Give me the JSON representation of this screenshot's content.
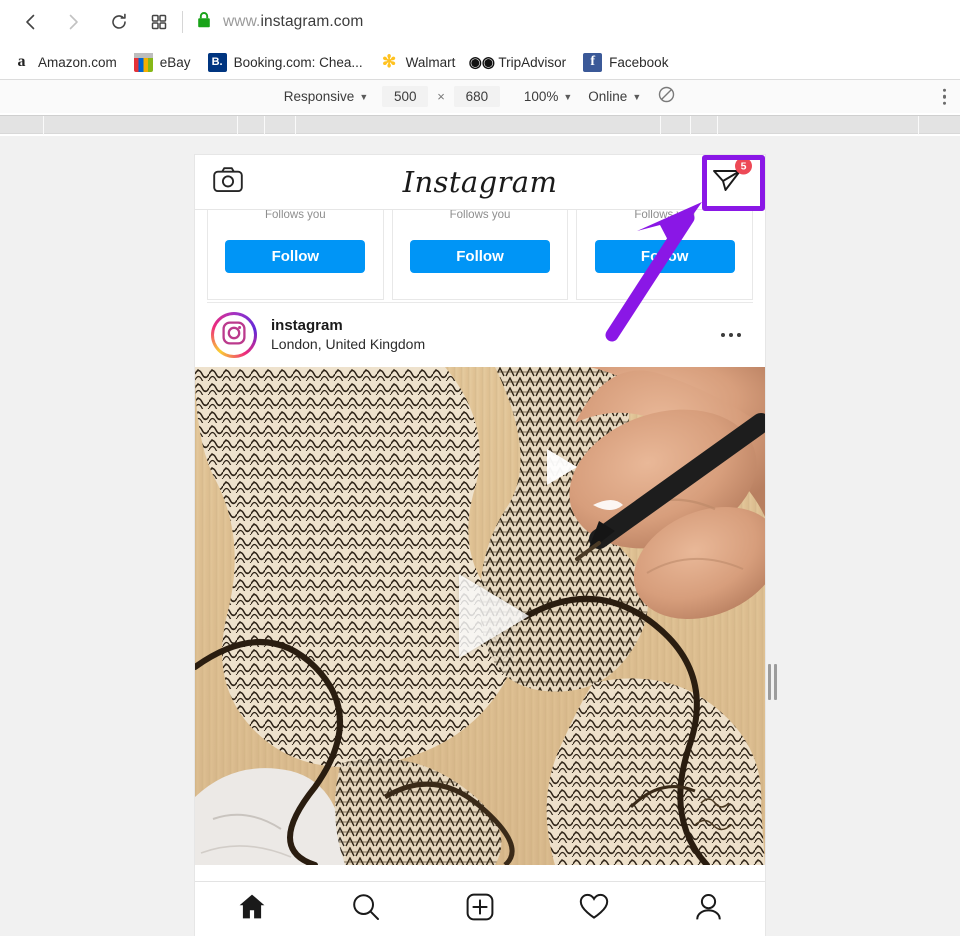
{
  "browser": {
    "url_protocol_prefix": "www.",
    "url": "instagram.com",
    "url_full": "www.instagram.com",
    "back_icon": "back-arrow-icon",
    "forward_icon": "forward-arrow-icon",
    "reload_icon": "reload-icon",
    "apps_icon": "grid-apps-icon",
    "lock_icon": "padlock-icon",
    "bookmarks": [
      {
        "label": "Amazon.com",
        "glyph": "a",
        "icon": "amazon-icon"
      },
      {
        "label": "eBay",
        "glyph": "",
        "icon": "ebay-icon"
      },
      {
        "label": "Booking.com: Chea...",
        "glyph": "B.",
        "icon": "booking-icon"
      },
      {
        "label": "Walmart",
        "glyph": "✻",
        "icon": "walmart-icon"
      },
      {
        "label": "TripAdvisor",
        "glyph": "◉◉",
        "icon": "tripadvisor-icon"
      },
      {
        "label": "Facebook",
        "glyph": "f",
        "icon": "facebook-icon"
      }
    ]
  },
  "device_toolbar": {
    "device_label": "Responsive",
    "width": "500",
    "separator": "×",
    "height": "680",
    "zoom": "100%",
    "network": "Online",
    "throttle_icon": "no-throttling-icon",
    "menu_icon": "kebab-menu-icon",
    "caret": "▼"
  },
  "ruler": {
    "ticks": [
      43,
      237,
      264,
      295,
      660,
      690,
      717,
      918
    ]
  },
  "instagram": {
    "header": {
      "camera_icon": "camera-icon",
      "logo": "Instagram",
      "dm_icon": "direct-message-icon",
      "dm_badge": "5"
    },
    "suggestions": [
      {
        "note": "Follows you",
        "follow_label": "Follow"
      },
      {
        "note": "Follows you",
        "follow_label": "Follow"
      },
      {
        "note": "Follows you",
        "follow_label": "Follow"
      }
    ],
    "post": {
      "avatar_icon": "instagram-avatar-icon",
      "username": "instagram",
      "location": "London, United Kingdom",
      "options_icon": "more-options-icon",
      "play_icon": "play-triangle-icon"
    },
    "bottom_nav": [
      {
        "icon": "home-icon",
        "name": "nav-home"
      },
      {
        "icon": "search-icon",
        "name": "nav-search"
      },
      {
        "icon": "add-post-icon",
        "name": "nav-add"
      },
      {
        "icon": "heart-icon",
        "name": "nav-activity"
      },
      {
        "icon": "profile-icon",
        "name": "nav-profile"
      }
    ]
  },
  "annotations": {
    "highlight_color": "#8a17e6",
    "arrow_color": "#8a17e6",
    "arrow_target": "direct-message-icon"
  },
  "colors": {
    "follow_blue": "#0095f6",
    "badge_red": "#ed4956",
    "lock_green": "#19a319",
    "accent_purple": "#8a17e6"
  }
}
